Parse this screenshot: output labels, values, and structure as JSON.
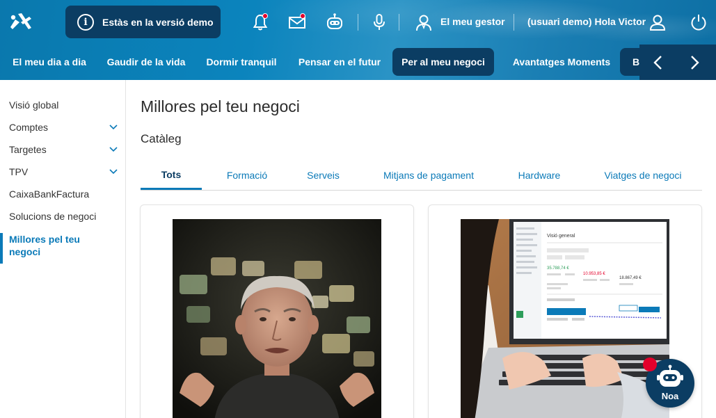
{
  "header": {
    "demo_notice": "Estàs en la versió demo",
    "manager_label": "El meu gestor",
    "user_greeting": "(usuari demo) Hola Victor"
  },
  "nav": {
    "items": [
      {
        "label": "El meu dia a dia",
        "active": false
      },
      {
        "label": "Gaudir de la vida",
        "active": false
      },
      {
        "label": "Dormir tranquil",
        "active": false
      },
      {
        "label": "Pensar en el futur",
        "active": false
      },
      {
        "label": "Per al meu negoci",
        "active": true
      },
      {
        "label": "Avantatges Moments",
        "active": false
      }
    ],
    "overflow_label": "B"
  },
  "sidebar": {
    "items": [
      {
        "label": "Visió global",
        "expandable": false
      },
      {
        "label": "Comptes",
        "expandable": true
      },
      {
        "label": "Targetes",
        "expandable": true
      },
      {
        "label": "TPV",
        "expandable": true
      },
      {
        "label": "CaixaBankFactura",
        "expandable": false
      },
      {
        "label": "Solucions de negoci",
        "expandable": false
      },
      {
        "label": "Millores pel teu negoci",
        "expandable": false,
        "active": true
      }
    ]
  },
  "main": {
    "title": "Millores pel teu negoci",
    "section": "Catàleg",
    "tabs": [
      {
        "label": "Tots",
        "active": true
      },
      {
        "label": "Formació",
        "active": false
      },
      {
        "label": "Serveis",
        "active": false
      },
      {
        "label": "Mitjans de pagament",
        "active": false
      },
      {
        "label": "Hardware",
        "active": false
      },
      {
        "label": "Viatges de negoci",
        "active": false
      }
    ],
    "laptop_screen": {
      "title": "Visió general",
      "ingresos": "35.788,74 €",
      "gastos": "10.953,85 €",
      "resultado": "18.867,49 €"
    }
  },
  "assistant": {
    "label": "Noa"
  },
  "colors": {
    "brand_blue": "#0b7ab8",
    "dark_navy": "#0b3d63",
    "alert_red": "#e4002b"
  }
}
